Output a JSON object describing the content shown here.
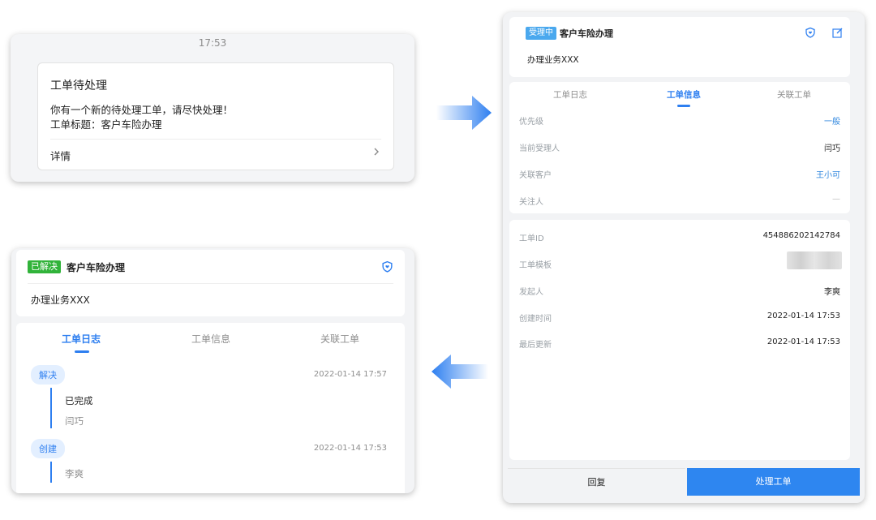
{
  "notification": {
    "time": "17:53",
    "title": "工单待处理",
    "line1": "你有一个新的待处理工单，请尽快处理！",
    "line2": "工单标题：客户车险办理",
    "detail_label": "详情"
  },
  "right_panel": {
    "status_badge": "受理中",
    "title": "客户车险办理",
    "subtitle": "办理业务XXX",
    "tabs": [
      "工单日志",
      "工单信息",
      "关联工单"
    ],
    "active_tab": 1,
    "info_rows": [
      {
        "label": "优先级",
        "value": "一般"
      },
      {
        "label": "当前受理人",
        "value": "闫巧"
      },
      {
        "label": "关联客户",
        "value": "王小可"
      },
      {
        "label": "关注人",
        "value": "—"
      }
    ],
    "meta_rows": [
      {
        "label": "工单ID",
        "value": "454886202142784"
      },
      {
        "label": "工单模板",
        "value": ""
      },
      {
        "label": "发起人",
        "value": "李爽"
      },
      {
        "label": "创建时间",
        "value": "2022-01-14 17:53"
      },
      {
        "label": "最后更新",
        "value": "2022-01-14 17:53"
      }
    ],
    "reply_button": "回复",
    "process_button": "处理工单"
  },
  "left_panel": {
    "status_badge": "已解决",
    "title": "客户车险办理",
    "subtitle": "办理业务XXX",
    "tabs": [
      "工单日志",
      "工单信息",
      "关联工单"
    ],
    "active_tab": 0,
    "timeline": [
      {
        "tag": "解决",
        "time": "2022-01-14 17:57",
        "text": "已完成",
        "person": "闫巧"
      },
      {
        "tag": "创建",
        "time": "2022-01-14 17:53",
        "person": "李爽"
      }
    ]
  },
  "colors": {
    "accent": "#2e7ff0",
    "badge_processing": "#4aa8ee",
    "badge_resolved": "#31b33a",
    "button_primary": "#2e86f0"
  },
  "icons": {
    "favorite": "shield-heart-icon",
    "edit": "edit-icon",
    "chevron": "chevron-right-icon",
    "flow_right": "arrow-right-icon",
    "flow_left": "arrow-left-icon"
  }
}
